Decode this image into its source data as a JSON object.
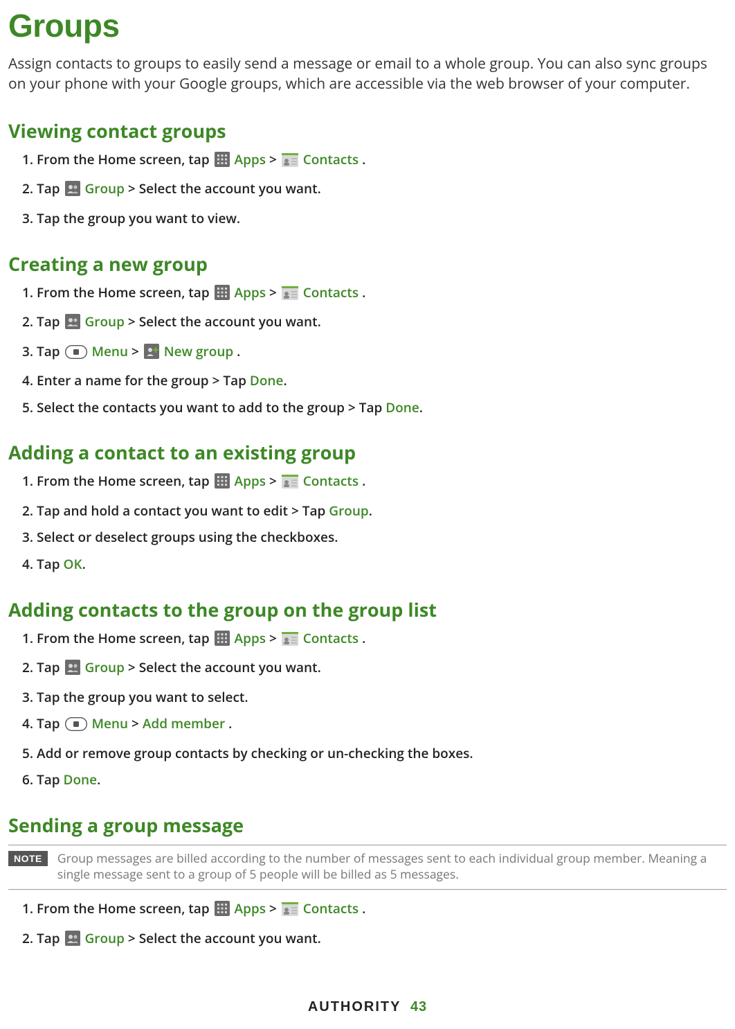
{
  "title": "Groups",
  "intro": "Assign contacts to groups to easily send a message or email to a whole group. You can also sync groups on your phone with your Google groups, which are accessible via the web browser of your computer.",
  "kw": {
    "apps": "Apps",
    "contacts": "Contacts",
    "group": "Group",
    "menu": "Menu",
    "newgroup": "New group",
    "done": "Done",
    "ok": "OK",
    "addmember": "Add member"
  },
  "sections": {
    "viewing": {
      "heading": "Viewing contact groups",
      "s1a": "1. From the Home screen, tap ",
      "s1b": " > ",
      "s1c": ".",
      "s2a": "2. Tap ",
      "s2b": " > Select the account you want.",
      "s3": "3. Tap the group you want to view."
    },
    "creating": {
      "heading": "Creating a new group",
      "s1a": "1. From the Home screen, tap ",
      "s1b": " > ",
      "s1c": ".",
      "s2a": "2. Tap ",
      "s2b": " > Select the account you want.",
      "s3a": "3. Tap ",
      "s3b": " > ",
      "s3c": ".",
      "s4a": "4. Enter a name for the group > Tap ",
      "s4b": ".",
      "s5a": "5. Select the contacts you want to add to the group > Tap ",
      "s5b": "."
    },
    "addcontact": {
      "heading": "Adding a contact to an existing group",
      "s1a": "1. From the Home screen, tap ",
      "s1b": " > ",
      "s1c": ".",
      "s2a": "2. Tap and hold a contact you want to edit > Tap ",
      "s2b": ".",
      "s3": "3. Select or deselect groups using the checkboxes.",
      "s4a": "4. Tap ",
      "s4b": "."
    },
    "addcontacts_list": {
      "heading": "Adding contacts to the group on the group list",
      "s1a": "1. From the Home screen, tap ",
      "s1b": " > ",
      "s1c": ".",
      "s2a": "2. Tap ",
      "s2b": " > Select the account you want.",
      "s3": "3. Tap the group you want to select.",
      "s4a": "4. Tap ",
      "s4b": " > ",
      "s4c": ".",
      "s5": "5. Add or remove group contacts by checking or un-checking the boxes.",
      "s6a": "6. Tap ",
      "s6b": "."
    },
    "sending": {
      "heading": "Sending a group message",
      "note_label": "NOTE",
      "note": "Group messages are billed according to the number of messages sent to each individual group member. Meaning a single message sent to a group of 5 people will be billed as 5 messages.",
      "s1a": "1. From the Home screen, tap ",
      "s1b": " > ",
      "s1c": ".",
      "s2a": "2. Tap ",
      "s2b": " > Select the account you want."
    }
  },
  "footer": {
    "brand": "AUTHORITY",
    "page": "43"
  }
}
